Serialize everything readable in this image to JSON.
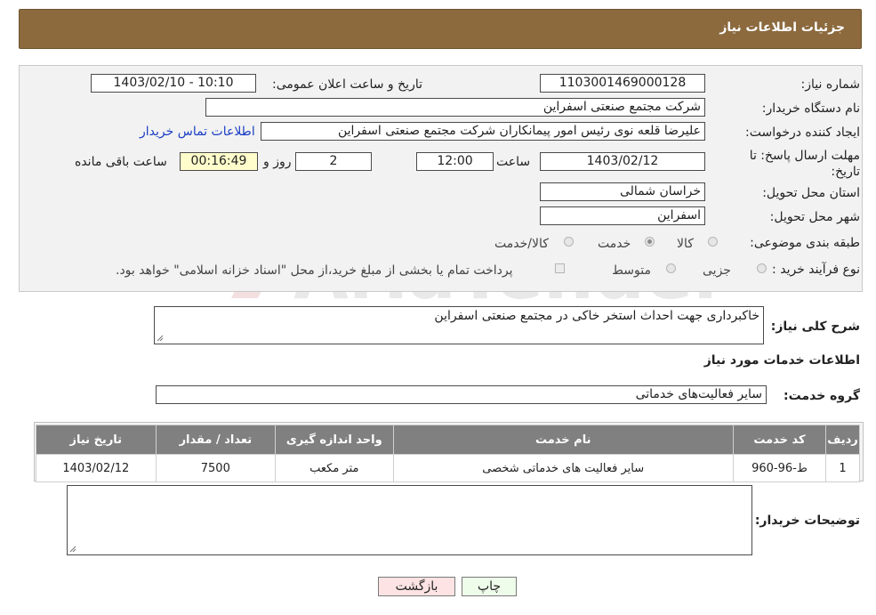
{
  "header": {
    "title": "جزئیات اطلاعات نیاز"
  },
  "form": {
    "need_number_label": "شماره نیاز:",
    "need_number": "1103001469000128",
    "announce_label": "تاریخ و ساعت اعلان عمومی:",
    "announce_value": "1403/02/10 - 10:10",
    "buyer_org_label": "نام دستگاه خریدار:",
    "buyer_org": "شرکت مجتمع صنعتی اسفراین",
    "creator_label": "ایجاد کننده درخواست:",
    "creator": "علیرضا قلعه نوی رئیس امور پیمانکاران شرکت مجتمع صنعتی اسفراین",
    "contact_link": "اطلاعات تماس خریدار",
    "deadline_label": "مهلت ارسال پاسخ: تا تاریخ:",
    "deadline_date": "1403/02/12",
    "time_label": "ساعت",
    "deadline_time": "12:00",
    "days": "2",
    "days_label": "روز و",
    "remaining": "00:16:49",
    "remaining_label": "ساعت باقی مانده",
    "province_label": "استان محل تحویل:",
    "province": "خراسان شمالی",
    "city_label": "شهر محل تحویل:",
    "city": "اسفراین",
    "category_label": "طبقه بندی موضوعی:",
    "category_options": [
      "کالا",
      "خدمت",
      "کالا/خدمت"
    ],
    "process_label": "نوع فرآیند خرید :",
    "process_options": [
      "جزیی",
      "متوسط"
    ],
    "process_note": "پرداخت تمام یا بخشی از مبلغ خرید،از محل \"اسناد خزانه اسلامی\" خواهد بود."
  },
  "summary": {
    "label": "شرح کلی نیاز:",
    "value": "خاکبرداری جهت احداث استخر خاکی در مجتمع صنعتی اسفراین"
  },
  "services": {
    "section_title": "اطلاعات خدمات مورد نیاز",
    "group_label": "گروه خدمت:",
    "group_value": "سایر فعالیت‌های خدماتی"
  },
  "table": {
    "headers": [
      "ردیف",
      "کد خدمت",
      "نام خدمت",
      "واحد اندازه گیری",
      "تعداد / مقدار",
      "تاریخ نیاز"
    ],
    "rows": [
      [
        "1",
        "ط-96-960",
        "سایر فعالیت های خدماتی شخصی",
        "متر مکعب",
        "7500",
        "1403/02/12"
      ]
    ]
  },
  "buyer_notes": {
    "label": "توضیحات خریدار:",
    "value": ""
  },
  "buttons": {
    "print": "چاپ",
    "back": "بازگشت"
  },
  "watermark": {
    "text": "AriaTender.neT"
  }
}
